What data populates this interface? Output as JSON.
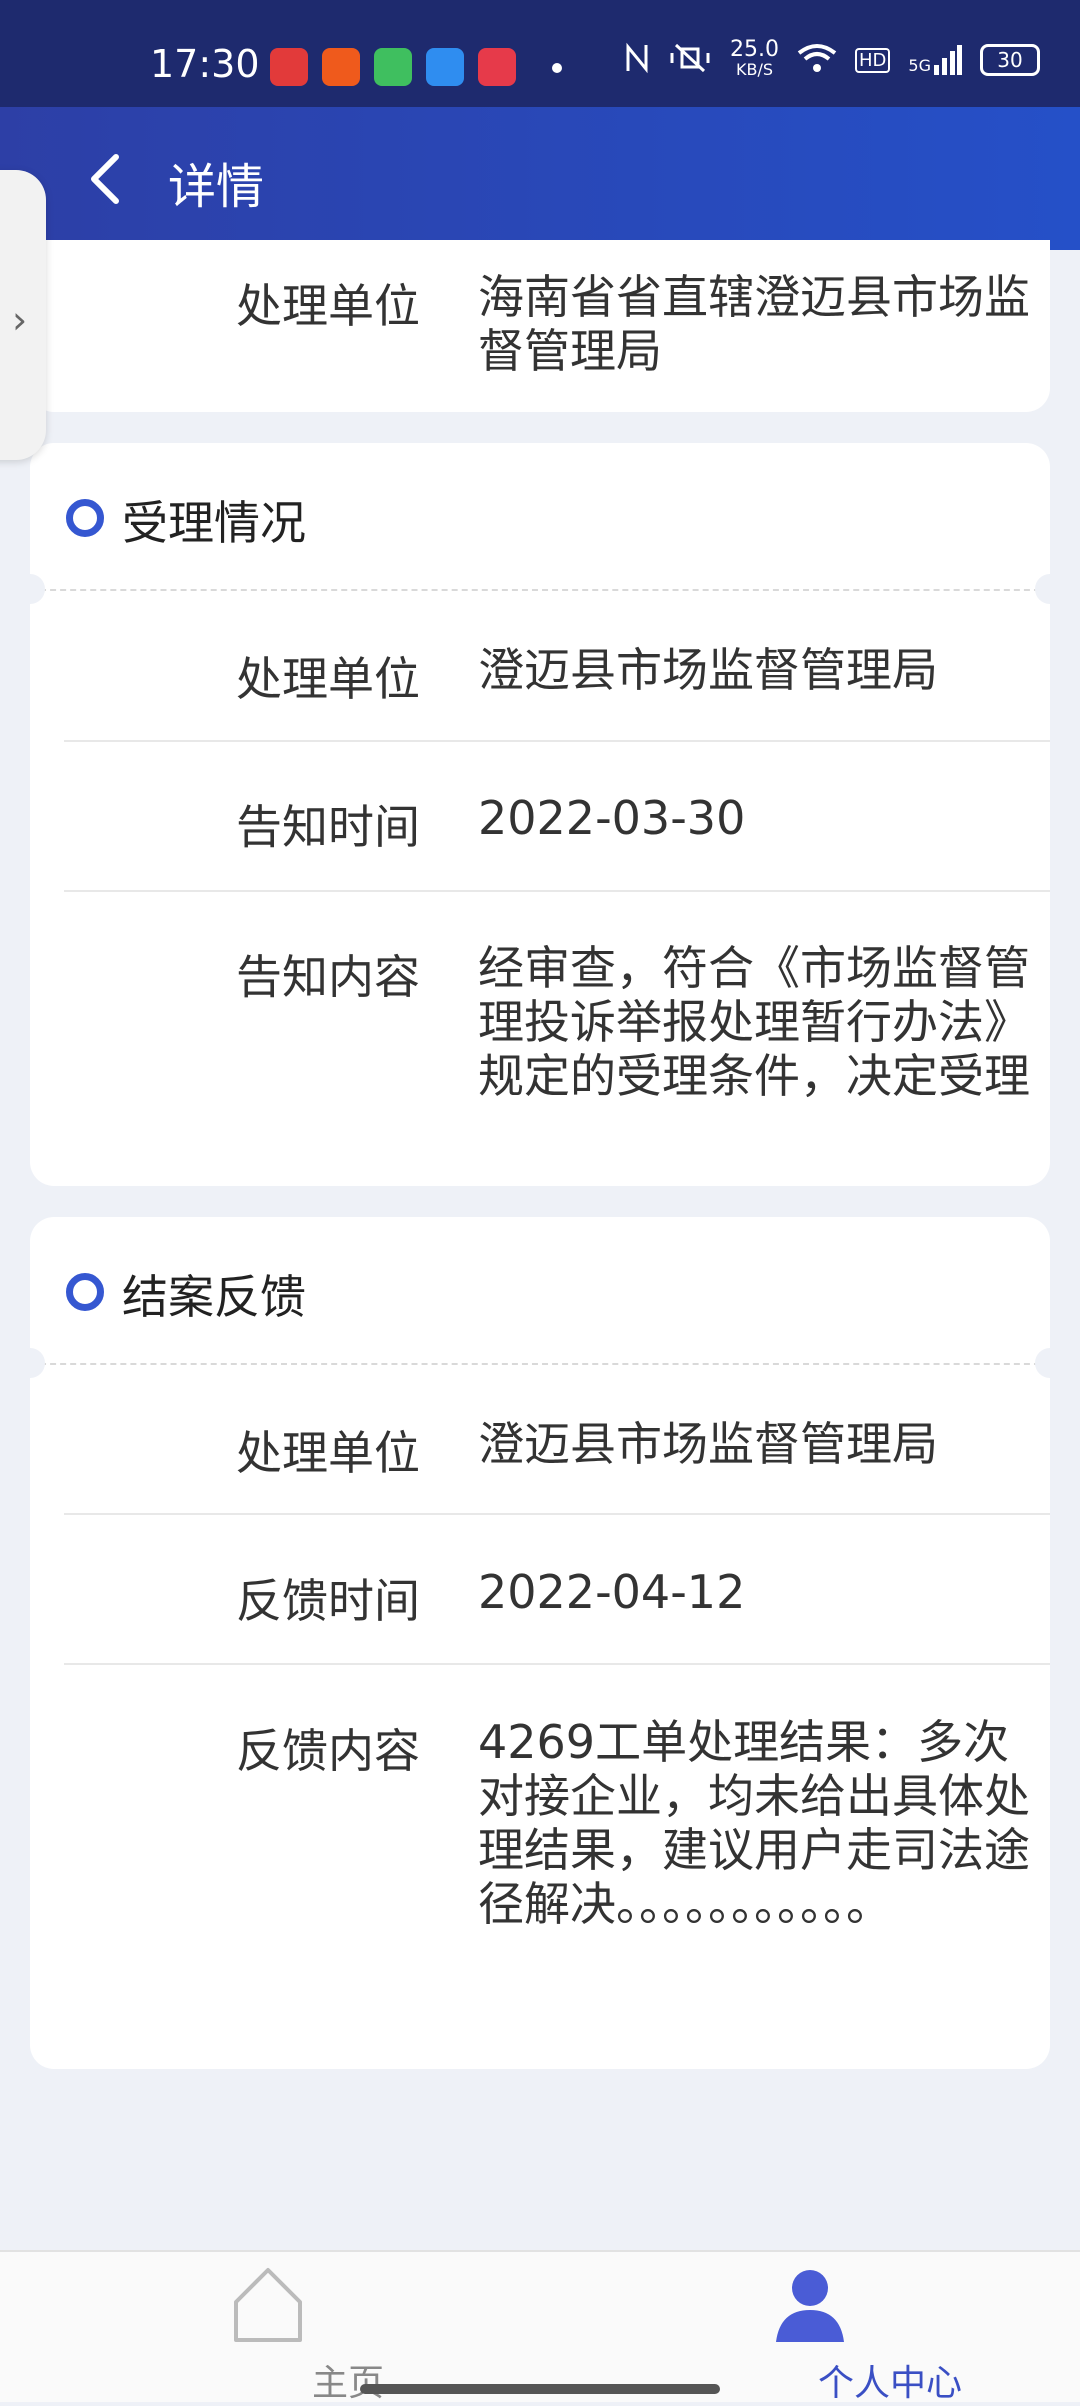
{
  "status_bar": {
    "time": "17:30",
    "net_speed": "25.0",
    "net_unit": "KB/S",
    "hd": "HD",
    "signal": "5G",
    "battery": "30"
  },
  "header": {
    "title": "详情"
  },
  "section0": {
    "rows": [
      {
        "label": "处理单位",
        "value": "海南省省直辖澄迈县市场监督管理局"
      }
    ]
  },
  "section1": {
    "title": "受理情况",
    "rows": [
      {
        "label": "处理单位",
        "value": "澄迈县市场监督管理局"
      },
      {
        "label": "告知时间",
        "value": "2022-03-30"
      },
      {
        "label": "告知内容",
        "value": "经审查，符合《市场监督管理投诉举报处理暂行办法》规定的受理条件，决定受理"
      }
    ]
  },
  "section2": {
    "title": "结案反馈",
    "rows": [
      {
        "label": "处理单位",
        "value": "澄迈县市场监督管理局"
      },
      {
        "label": "反馈时间",
        "value": "2022-04-12"
      },
      {
        "label": "反馈内容",
        "value": "4269工单处理结果：多次对接企业，均未给出具体处理结果，建议用户走司法途径解决。。。。。。。。。。。"
      }
    ]
  },
  "tabbar": {
    "home_label": "主页",
    "me_label": "个人中心"
  },
  "colors": {
    "accent": "#3a4fc4",
    "header": "#2d3fa6",
    "statusbar": "#1e2a6e"
  }
}
